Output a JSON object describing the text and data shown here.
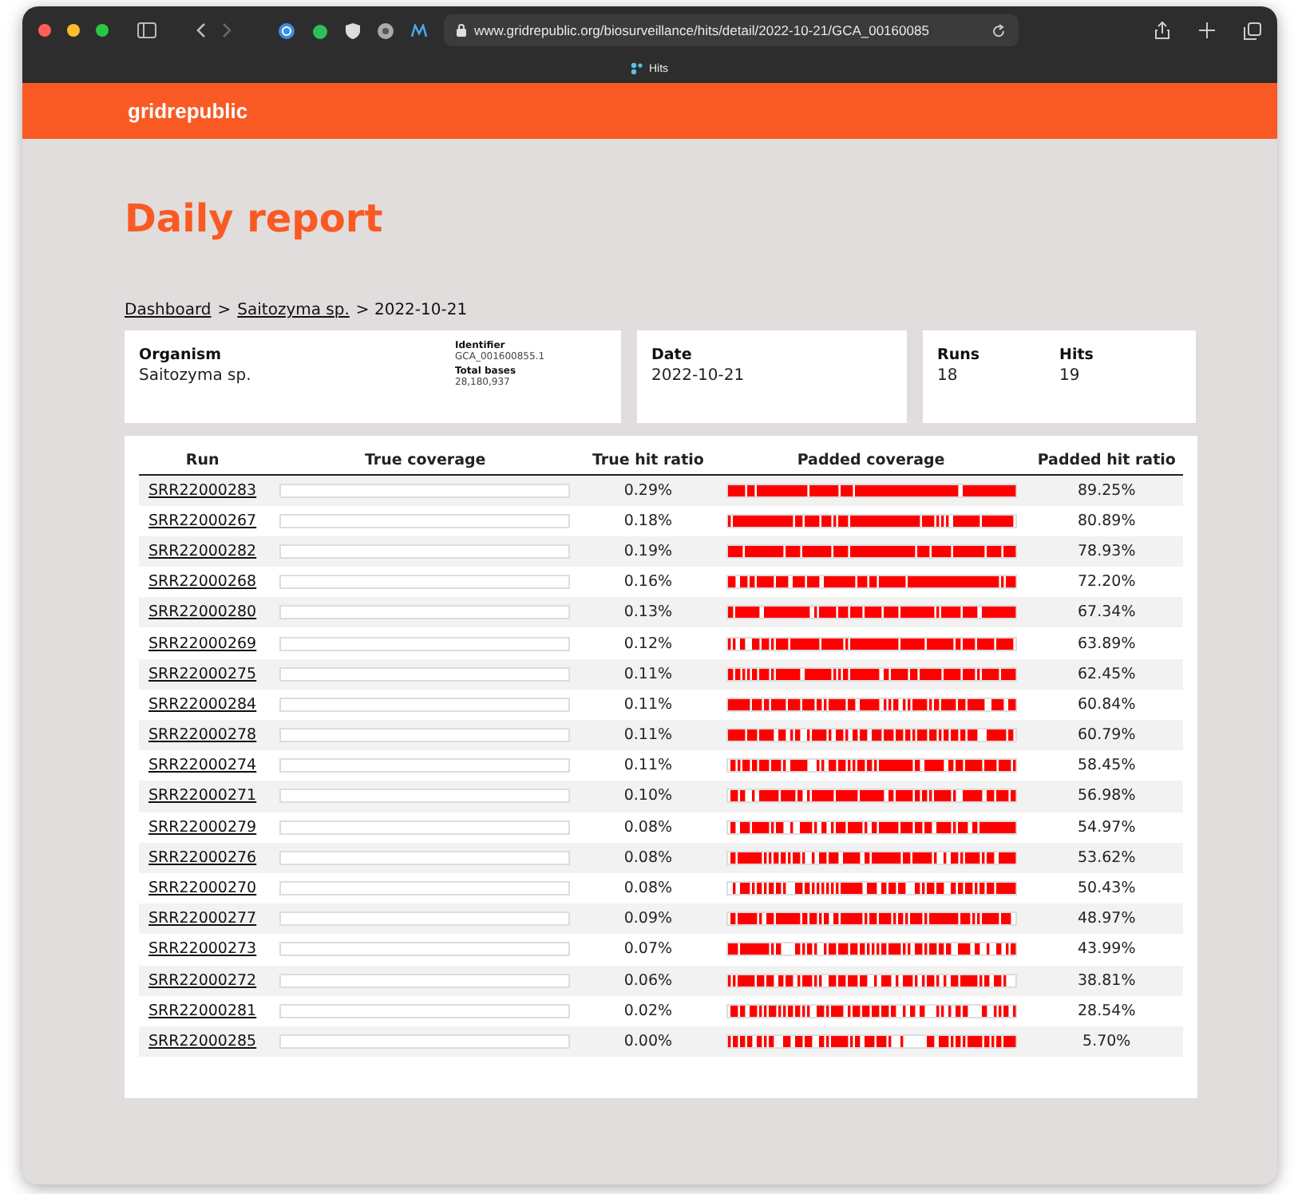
{
  "browser": {
    "url": "www.gridrepublic.org/biosurveillance/hits/detail/2022-10-21/GCA_00160085",
    "tab": "Hits"
  },
  "site": {
    "brand": "gridrepublic"
  },
  "title": "Daily report",
  "breadcrumb": [
    {
      "label": "Dashboard",
      "link": true
    },
    {
      "label": ">",
      "link": false
    },
    {
      "label": "Saitozyma sp.",
      "link": true
    },
    {
      "label": "> 2022-10-21",
      "link": false
    }
  ],
  "organism": {
    "label": "Organism",
    "value": "Saitozyma sp.",
    "identifier_label": "Identifier",
    "identifier": "GCA_001600855.1",
    "bases_label": "Total bases",
    "bases": "28,180,937"
  },
  "date": {
    "label": "Date",
    "value": "2022-10-21"
  },
  "stats": [
    {
      "label": "Runs",
      "value": "18"
    },
    {
      "label": "Hits",
      "value": "19"
    }
  ],
  "table": {
    "columns": [
      "Run",
      "True coverage",
      "True hit ratio",
      "Padded coverage",
      "Padded hit ratio"
    ],
    "rows": [
      {
        "run": "SRR22000283",
        "true_ratio": "0.29%",
        "padded_ratio": "89.25%"
      },
      {
        "run": "SRR22000267",
        "true_ratio": "0.18%",
        "padded_ratio": "80.89%"
      },
      {
        "run": "SRR22000282",
        "true_ratio": "0.19%",
        "padded_ratio": "78.93%"
      },
      {
        "run": "SRR22000268",
        "true_ratio": "0.16%",
        "padded_ratio": "72.20%"
      },
      {
        "run": "SRR22000280",
        "true_ratio": "0.13%",
        "padded_ratio": "67.34%"
      },
      {
        "run": "SRR22000269",
        "true_ratio": "0.12%",
        "padded_ratio": "63.89%"
      },
      {
        "run": "SRR22000275",
        "true_ratio": "0.11%",
        "padded_ratio": "62.45%"
      },
      {
        "run": "SRR22000284",
        "true_ratio": "0.11%",
        "padded_ratio": "60.84%"
      },
      {
        "run": "SRR22000278",
        "true_ratio": "0.11%",
        "padded_ratio": "60.79%"
      },
      {
        "run": "SRR22000274",
        "true_ratio": "0.11%",
        "padded_ratio": "58.45%"
      },
      {
        "run": "SRR22000271",
        "true_ratio": "0.10%",
        "padded_ratio": "56.98%"
      },
      {
        "run": "SRR22000279",
        "true_ratio": "0.08%",
        "padded_ratio": "54.97%"
      },
      {
        "run": "SRR22000276",
        "true_ratio": "0.08%",
        "padded_ratio": "53.62%"
      },
      {
        "run": "SRR22000270",
        "true_ratio": "0.08%",
        "padded_ratio": "50.43%"
      },
      {
        "run": "SRR22000277",
        "true_ratio": "0.09%",
        "padded_ratio": "48.97%"
      },
      {
        "run": "SRR22000273",
        "true_ratio": "0.07%",
        "padded_ratio": "43.99%"
      },
      {
        "run": "SRR22000272",
        "true_ratio": "0.06%",
        "padded_ratio": "38.81%"
      },
      {
        "run": "SRR22000281",
        "true_ratio": "0.02%",
        "padded_ratio": "28.54%"
      },
      {
        "run": "SRR22000285",
        "true_ratio": "0.00%",
        "padded_ratio": "5.70%"
      }
    ]
  }
}
